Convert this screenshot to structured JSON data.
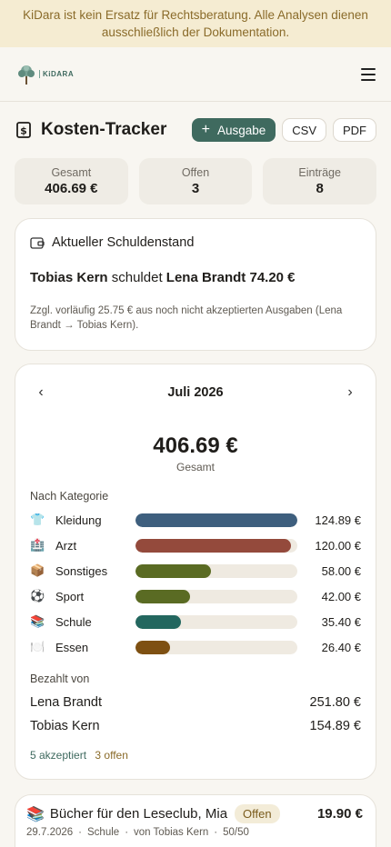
{
  "banner": {
    "text": "KiDara ist kein Ersatz für Rechtsberatung. Alle Analysen dienen ausschließlich der Dokumentation."
  },
  "app": {
    "logo_text": "KiDARA",
    "menu_icon": "hamburger-menu-icon"
  },
  "header": {
    "title": "Kosten-Tracker",
    "add_label": "Ausgabe",
    "csv_label": "CSV",
    "pdf_label": "PDF"
  },
  "stats": [
    {
      "label": "Gesamt",
      "value": "406.69 €"
    },
    {
      "label": "Offen",
      "value": "3"
    },
    {
      "label": "Einträge",
      "value": "8"
    }
  ],
  "debt": {
    "heading": "Aktueller Schuldenstand",
    "debtor": "Tobias Kern",
    "verb": "schuldet",
    "creditor_amount": "Lena Brandt 74.20 €",
    "note": "Zzgl. vorläufig 25.75 € aus noch nicht akzeptierten Ausgaben (Lena Brandt → Tobias Kern)."
  },
  "month": {
    "label": "Juli 2026",
    "total": "406.69 €",
    "total_label": "Gesamt",
    "category_heading": "Nach Kategorie",
    "paid_heading": "Bezahlt von",
    "accepted": "5 akzeptiert",
    "open": "3 offen"
  },
  "chart_data": {
    "type": "bar",
    "title": "Nach Kategorie",
    "categories": [
      "Kleidung",
      "Arzt",
      "Sonstiges",
      "Sport",
      "Schule",
      "Essen"
    ],
    "values": [
      124.89,
      120.0,
      58.0,
      42.0,
      35.4,
      26.4
    ],
    "labels": [
      "124.89 €",
      "120.00 €",
      "58.00 €",
      "42.00 €",
      "35.40 €",
      "26.40 €"
    ],
    "icons": [
      "👕",
      "🏥",
      "📦",
      "⚽",
      "📚",
      "🍽️"
    ],
    "colors": [
      "#3e5f7e",
      "#944a3c",
      "#5a6b23",
      "#5a6b23",
      "#23675f",
      "#7e5012"
    ],
    "xlim": [
      0,
      124.89
    ]
  },
  "paid_by": [
    {
      "name": "Lena Brandt",
      "amount": "251.80 €"
    },
    {
      "name": "Tobias Kern",
      "amount": "154.89 €"
    }
  ],
  "entry": {
    "icon": "📚",
    "title": "Bücher für den Leseclub, Mia",
    "badge": "Offen",
    "amount": "19.90 €",
    "date": "29.7.2026",
    "category": "Schule",
    "payer": "von Tobias Kern",
    "split": "50/50"
  }
}
